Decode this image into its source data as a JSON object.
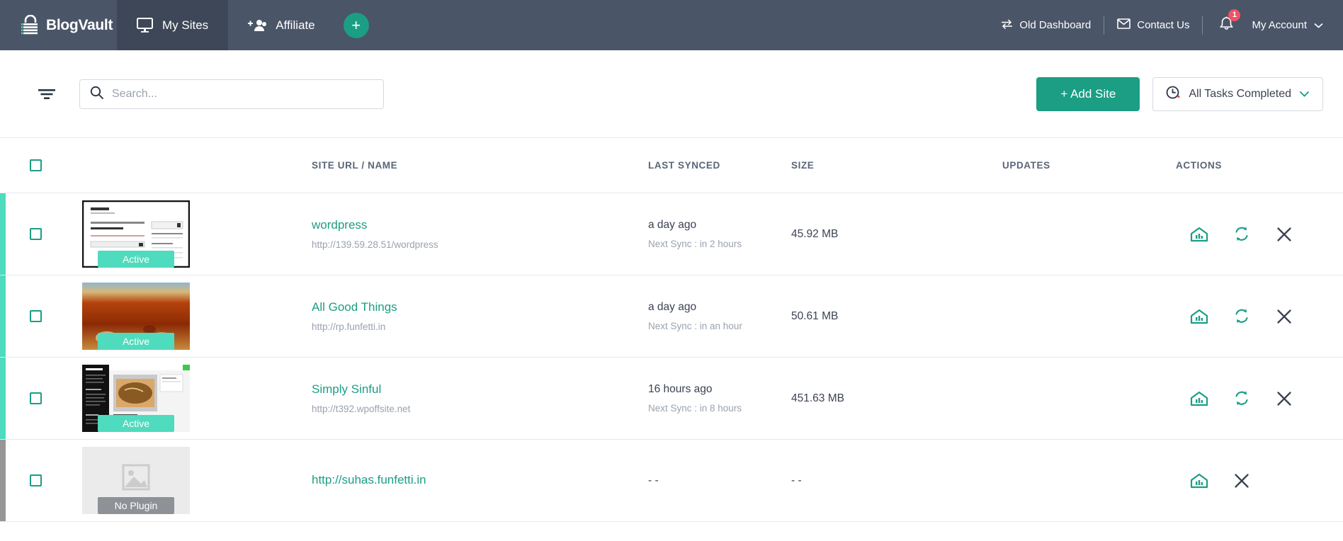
{
  "brand": {
    "name": "BlogVault",
    "logo_icon": "blogvault-lock-icon"
  },
  "topnav": {
    "tabs": [
      {
        "label": "My Sites",
        "icon": "monitor-icon",
        "active": true
      },
      {
        "label": "Affiliate",
        "icon": "add-people-icon",
        "active": false
      }
    ],
    "add_button_label": "+",
    "right": {
      "old_dashboard": {
        "label": "Old Dashboard",
        "icon": "swap-arrows-icon"
      },
      "contact_us": {
        "label": "Contact Us",
        "icon": "envelope-icon"
      },
      "notifications": {
        "icon": "bell-icon",
        "badge_count": "1"
      },
      "my_account": {
        "label": "My Account",
        "icon": "chevron-down-icon"
      }
    }
  },
  "toolbar": {
    "filter_icon": "filter-icon",
    "search": {
      "placeholder": "Search...",
      "value": "",
      "icon": "search-icon"
    },
    "add_site_label": "+ Add Site",
    "tasks_label": "All Tasks Completed",
    "tasks_icon": "clock-icon",
    "tasks_chevron": "chevron-down-icon"
  },
  "table": {
    "columns": {
      "site": "SITE URL / NAME",
      "last_synced": "LAST SYNCED",
      "size": "SIZE",
      "updates": "UPDATES",
      "actions": "ACTIONS"
    },
    "rows": [
      {
        "name": "wordpress",
        "url": "http://139.59.28.51/wordpress",
        "badge": "Active",
        "badge_type": "active",
        "stripe_color": "#4fdbbd",
        "last_synced": "a day ago",
        "next_sync": "Next Sync : in 2 hours",
        "size": "45.92 MB",
        "updates": "",
        "thumb_type": "wordpress-page",
        "actions": [
          "dashboard-icon",
          "sync-icon",
          "remove-icon"
        ]
      },
      {
        "name": "All Good Things",
        "url": "http://rp.funfetti.in",
        "badge": "Active",
        "badge_type": "active",
        "stripe_color": "#4fdbbd",
        "last_synced": "a day ago",
        "next_sync": "Next Sync : in an hour",
        "size": "50.61 MB",
        "updates": "",
        "thumb_type": "food-photo",
        "actions": [
          "dashboard-icon",
          "sync-icon",
          "remove-icon"
        ]
      },
      {
        "name": "Simply Sinful",
        "url": "http://t392.wpoffsite.net",
        "badge": "Active",
        "badge_type": "active",
        "stripe_color": "#4fdbbd",
        "last_synced": "16 hours ago",
        "next_sync": "Next Sync : in 8 hours",
        "size": "451.63 MB",
        "updates": "",
        "thumb_type": "blog-dark",
        "actions": [
          "dashboard-icon",
          "sync-icon",
          "remove-icon"
        ]
      },
      {
        "name": "http://suhas.funfetti.in",
        "url": "",
        "badge": "No Plugin",
        "badge_type": "noplugin",
        "stripe_color": "#969696",
        "last_synced": "- -",
        "next_sync": "",
        "size": "- -",
        "updates": "",
        "thumb_type": "placeholder",
        "actions": [
          "dashboard-icon",
          "remove-icon"
        ]
      }
    ]
  },
  "colors": {
    "nav_bg": "#4a5568",
    "nav_active": "#3d4757",
    "accent_teal": "#1b9e84",
    "accent_mint": "#4fdbbd",
    "badge_red": "#f05365",
    "text_muted": "#9aa2ae"
  }
}
